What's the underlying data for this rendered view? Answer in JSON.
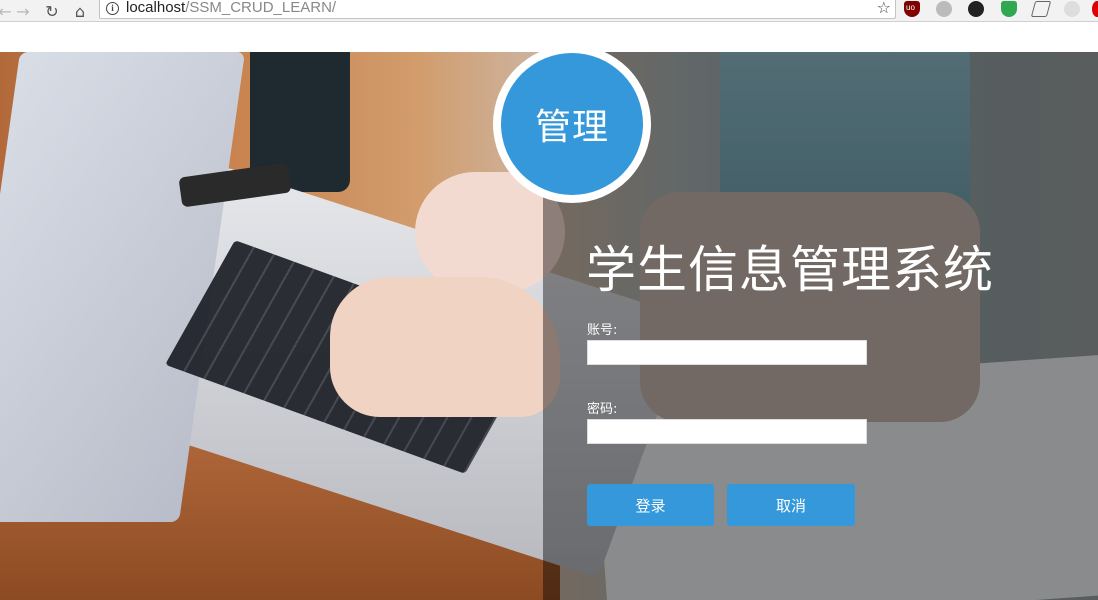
{
  "browser": {
    "url_host": "localhost",
    "url_path": "/SSM_CRUD_LEARN/",
    "extensions": [
      "ublock-origin-icon",
      "extension-grey-icon",
      "owl-extension-icon",
      "shield-extension-icon",
      "pen-extension-icon",
      "extension-light-icon",
      "extension-red-icon"
    ]
  },
  "login": {
    "badge_text": "管理",
    "title": "学生信息管理系统",
    "username_label": "账号:",
    "username_value": "",
    "password_label": "密码:",
    "password_value": "",
    "login_button": "登录",
    "cancel_button": "取消"
  },
  "colors": {
    "accent": "#3498db",
    "overlay": "rgba(0,0,0,0.42)"
  }
}
